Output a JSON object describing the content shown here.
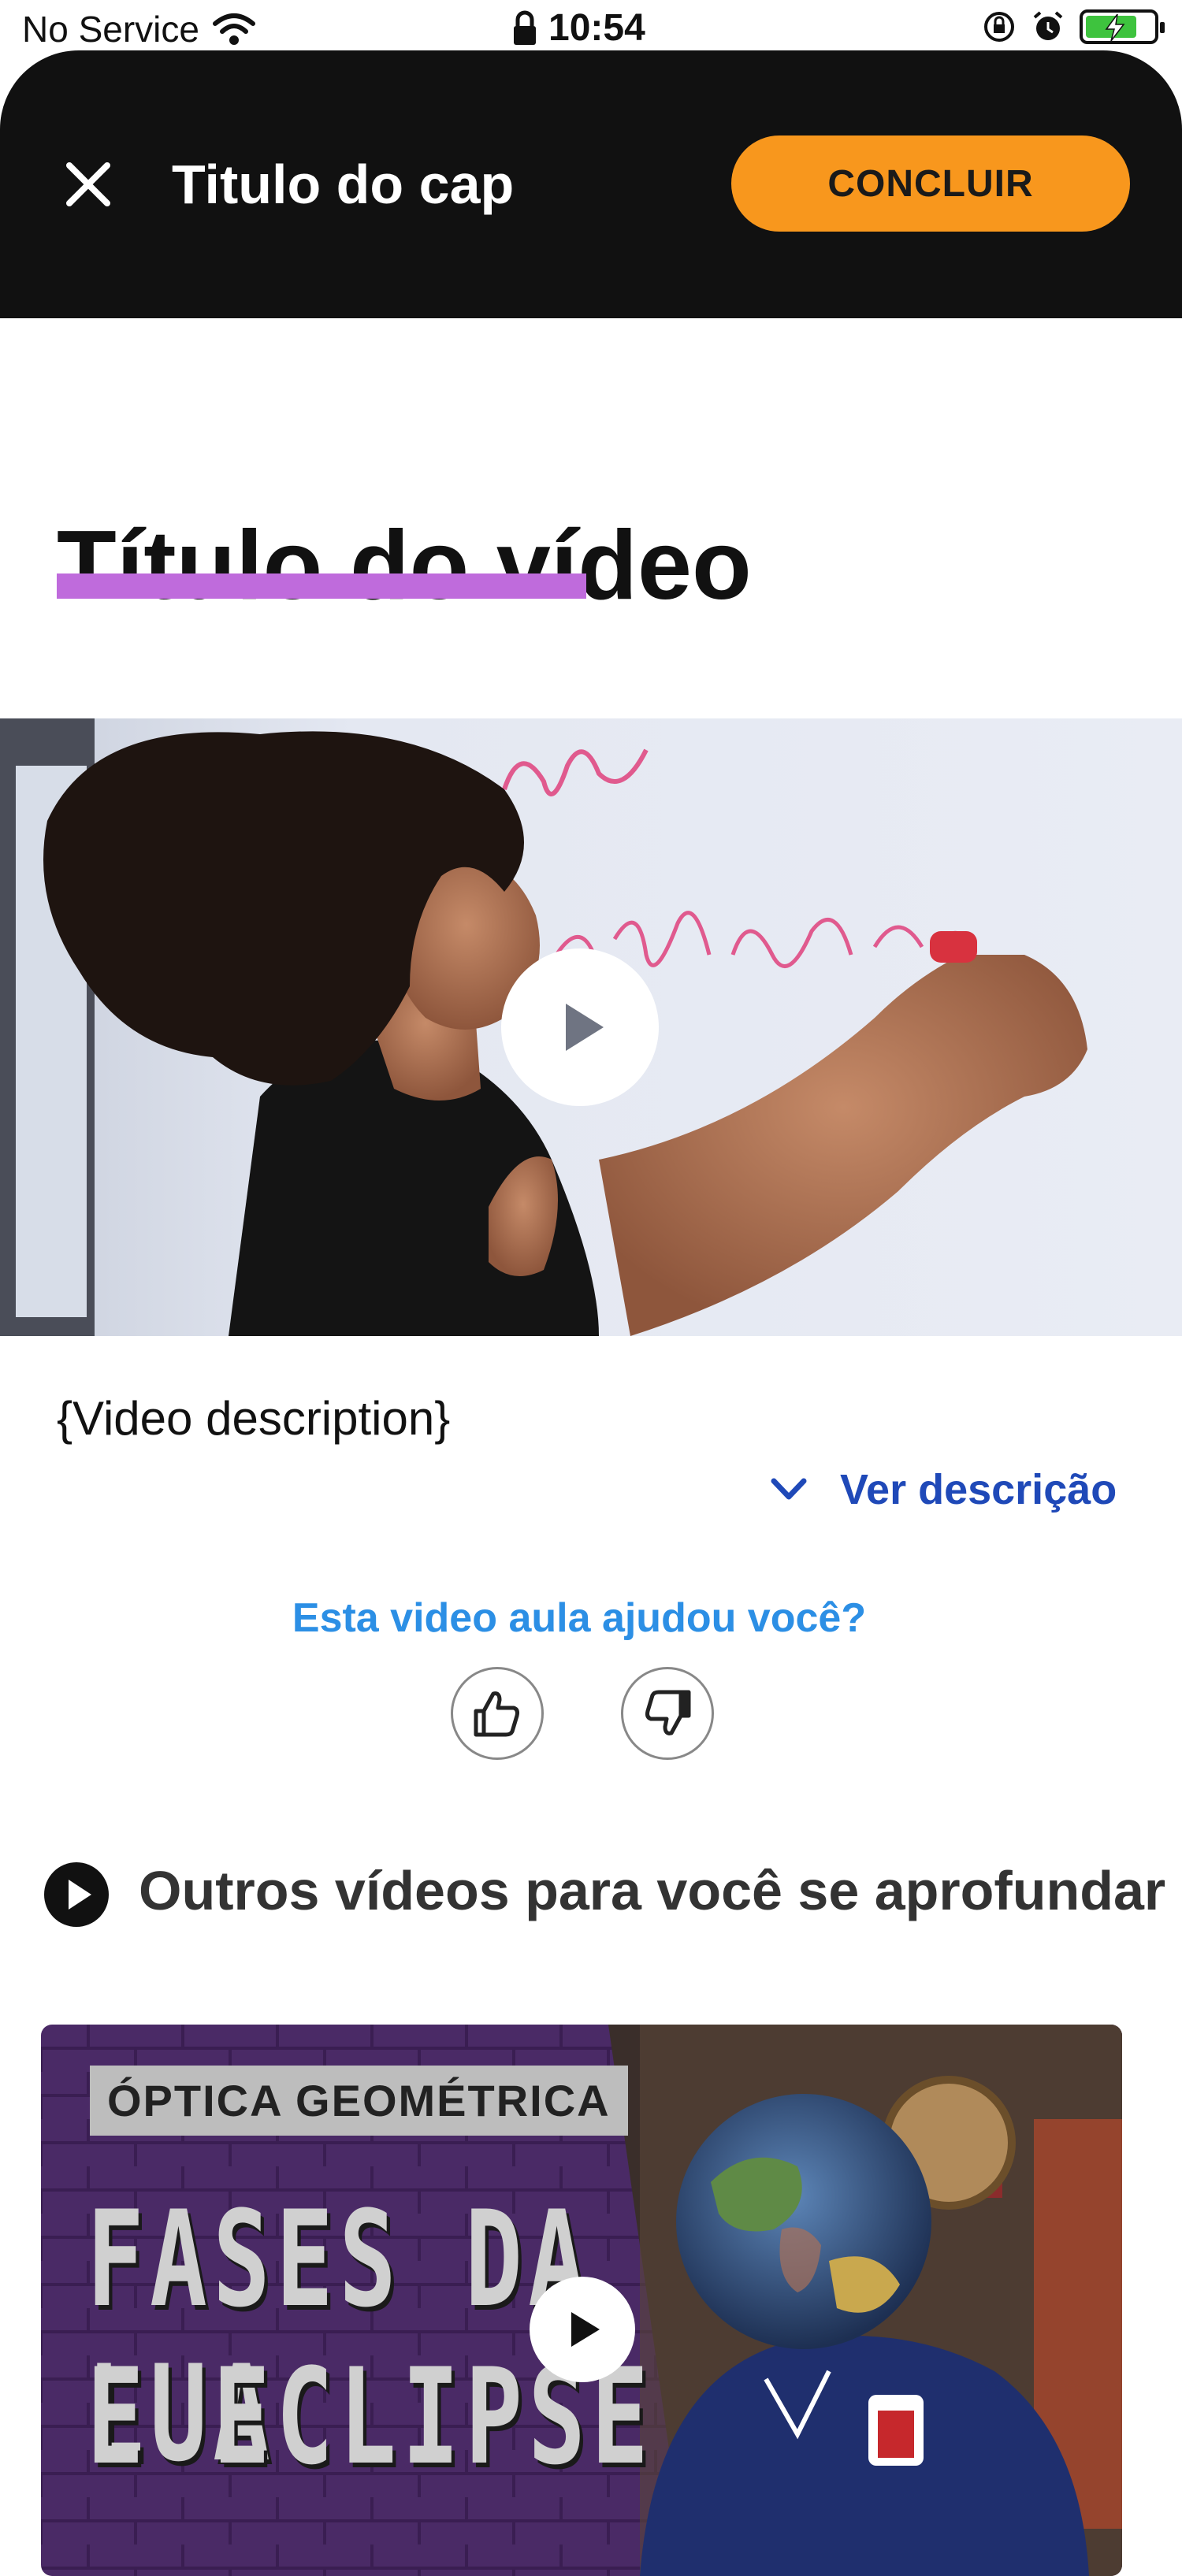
{
  "status_bar": {
    "carrier": "No Service",
    "time": "10:54"
  },
  "header": {
    "title": "Titulo do cap",
    "action_label": "CONCLUIR",
    "accent_color": "#f8971d"
  },
  "video": {
    "title": "Título do vídeo",
    "underline_color": "#bf6bdc",
    "description": "{Video description}",
    "expand_label": "Ver descrição"
  },
  "feedback": {
    "question": "Esta video aula ajudou você?",
    "like_icon": "thumbs-up-icon",
    "dislike_icon": "thumbs-down-icon"
  },
  "related": {
    "section_title": "Outros vídeos para você se aprofundar",
    "items": [
      {
        "topic": "ÓPTICA GEOMÉTRICA",
        "title_line_1": "FASES DA LUA",
        "title_line_2": "E ECLIPSE"
      }
    ]
  }
}
